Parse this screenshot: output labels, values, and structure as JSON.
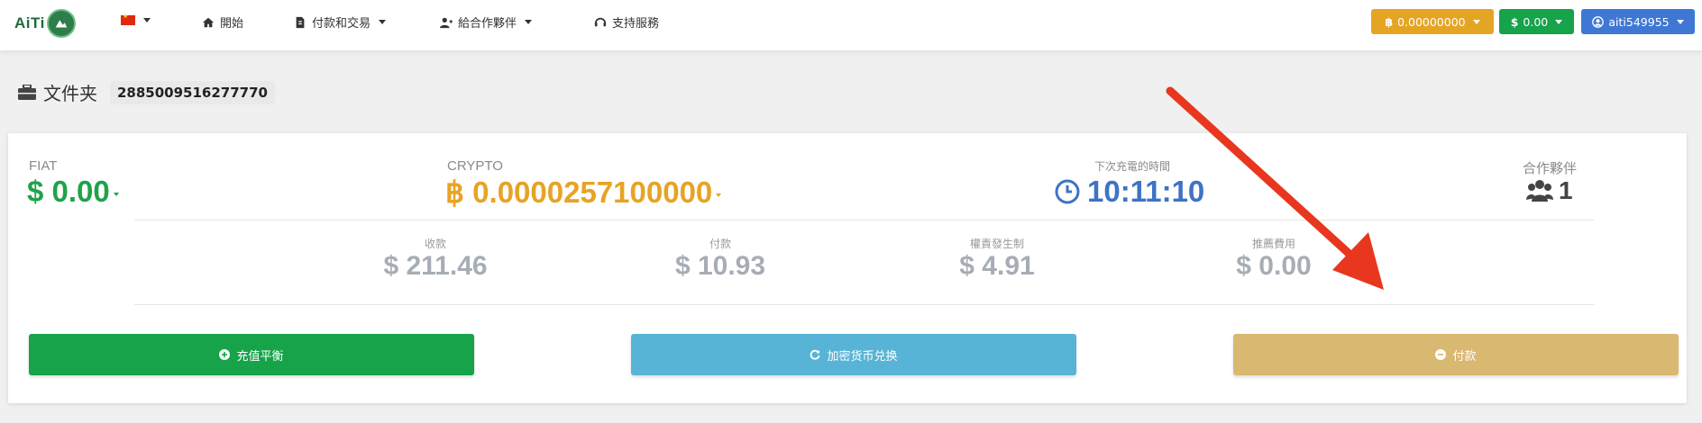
{
  "navbar": {
    "logo_text": "AiTi",
    "menu": [
      {
        "label": "開始",
        "icon": "home-icon"
      },
      {
        "label": "付款和交易",
        "icon": "file-icon"
      },
      {
        "label": "給合作夥伴",
        "icon": "user-plus-icon"
      },
      {
        "label": "支持服務",
        "icon": "headset-icon"
      }
    ],
    "language_flag": "cn-flag-icon",
    "crypto_balance": "0.00000000",
    "fiat_balance": "0.00",
    "username": "aiti549955"
  },
  "header": {
    "title": "文件夹",
    "wallet_id": "2885009516277770"
  },
  "stats": {
    "fiat_label": "FIAT",
    "fiat_value": "0.00",
    "crypto_label": "CRYPTO",
    "crypto_value": "0.0000257100000",
    "next_charge_label": "下次充電的時間",
    "next_charge_time": "10:11:10",
    "partners_label": "合作夥伴",
    "partners_count": "1"
  },
  "sub_stats": [
    {
      "label": "收款",
      "value": "$ 211.46"
    },
    {
      "label": "付款",
      "value": "$ 10.93"
    },
    {
      "label": "權責發生制",
      "value": "$ 4.91"
    },
    {
      "label": "推薦費用",
      "value": "$ 0.00"
    }
  ],
  "actions": {
    "deposit": "充值平衡",
    "exchange": "加密货币兑换",
    "pay": "付款"
  },
  "colors": {
    "green": "#16a34a",
    "orange": "#e5a524",
    "blue": "#3f78d4",
    "light_blue": "#58b4d6",
    "tan": "#d9b871",
    "annotation_arrow": "#e8361f"
  }
}
